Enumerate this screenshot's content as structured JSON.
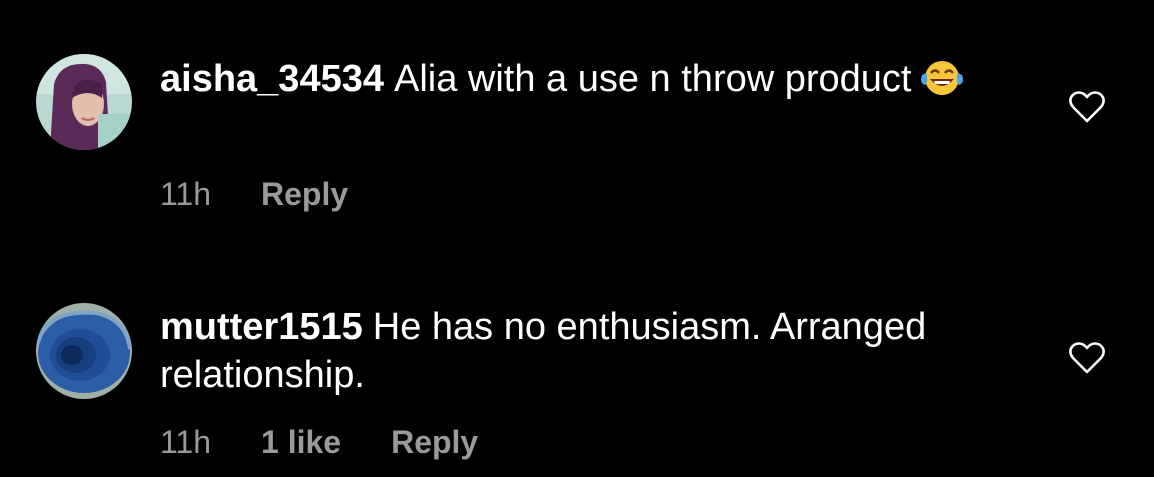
{
  "comments": [
    {
      "username": "aisha_34534",
      "text": "Alia with a use n throw product",
      "emoji": "face-with-tears-of-joy",
      "time": "11h",
      "likes": "",
      "reply_label": "Reply"
    },
    {
      "username": "mutter1515",
      "text": "He has no enthusiasm. Arranged relationship.",
      "time": "11h",
      "likes": "1 like",
      "reply_label": "Reply"
    }
  ],
  "colors": {
    "background": "#000000",
    "text": "#ffffff",
    "meta": "#9a9a9a"
  },
  "icons": [
    "heart-outline-icon",
    "face-with-tears-of-joy-emoji"
  ]
}
